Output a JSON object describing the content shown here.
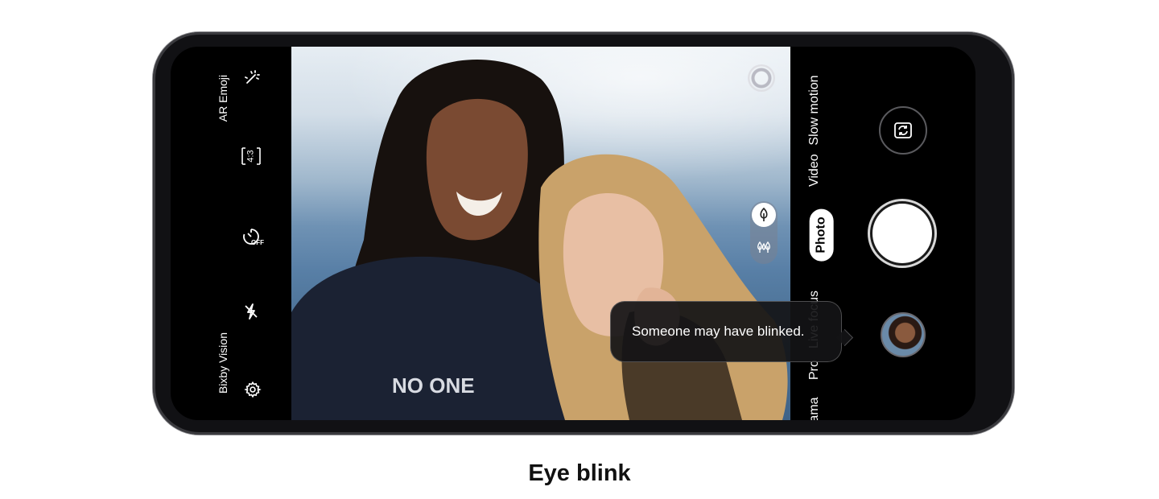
{
  "left_controls": {
    "ar_emoji_label": "AR Emoji",
    "aspect_ratio": "4:3",
    "timer_label": "OFF",
    "bixby_vision_label": "Bixby Vision",
    "icons": [
      "effects-icon",
      "aspect-ratio-icon",
      "timer-off-icon",
      "flash-off-icon",
      "settings-icon"
    ]
  },
  "camera_modes": {
    "items": [
      "Slow motion",
      "Video",
      "Photo",
      "Live focus",
      "Pro",
      "Panorama"
    ],
    "active": "Photo",
    "visible_text": {
      "slow_motion": "Slow motion",
      "video": "Video",
      "photo": "Photo",
      "live_focus": "Live focus",
      "pro": "Pro",
      "panorama_partial": "ama"
    }
  },
  "toast": {
    "message": "Someone may have blinked."
  },
  "caption": "Eye blink",
  "colors": {
    "screen_bg": "#000000",
    "phone_body": "#111114",
    "active_mode_bg": "#ffffff",
    "caption_text": "#111111"
  }
}
